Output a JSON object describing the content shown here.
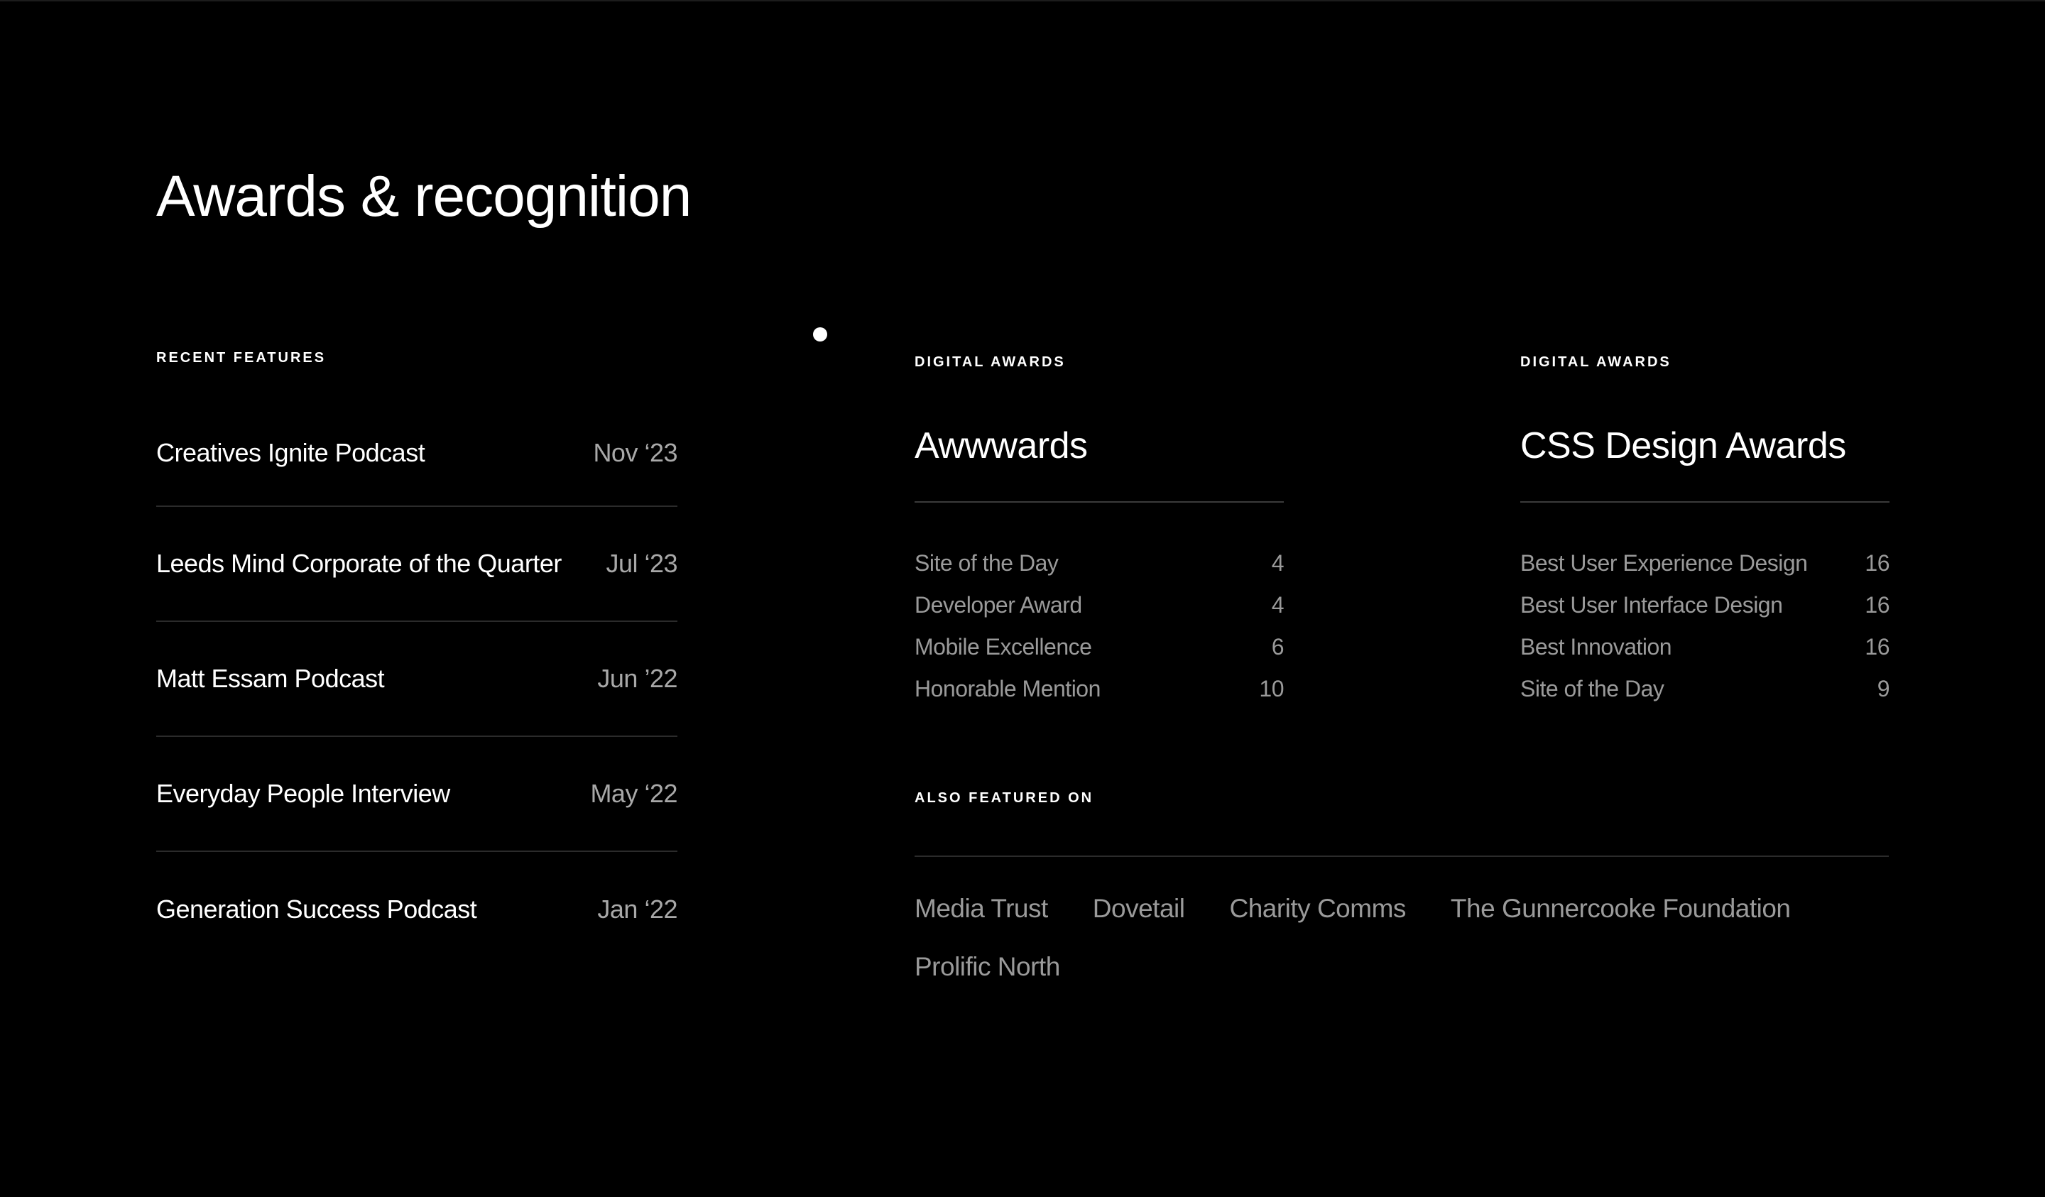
{
  "page": {
    "title": "Awards & recognition"
  },
  "recent_features": {
    "heading": "Recent features",
    "items": [
      {
        "name": "Creatives Ignite Podcast",
        "date": "Nov ‘23"
      },
      {
        "name": "Leeds Mind Corporate of the Quarter",
        "date": "Jul ‘23"
      },
      {
        "name": "Matt Essam Podcast",
        "date": "Jun ’22"
      },
      {
        "name": "Everyday People Interview",
        "date": "May ‘22"
      },
      {
        "name": "Generation Success Podcast",
        "date": "Jan ‘22"
      }
    ]
  },
  "awards": [
    {
      "eyebrow": "Digital awards",
      "title": "Awwwards",
      "items": [
        {
          "label": "Site of the Day",
          "count": "4"
        },
        {
          "label": "Developer Award",
          "count": "4"
        },
        {
          "label": "Mobile Excellence",
          "count": "6"
        },
        {
          "label": "Honorable Mention",
          "count": "10"
        }
      ]
    },
    {
      "eyebrow": "Digital awards",
      "title": "CSS Design Awards",
      "items": [
        {
          "label": "Best User Experience Design",
          "count": "16"
        },
        {
          "label": "Best User Interface Design",
          "count": "16"
        },
        {
          "label": "Best Innovation",
          "count": "16"
        },
        {
          "label": "Site of the Day",
          "count": "9"
        }
      ]
    }
  ],
  "also_featured": {
    "heading": "Also featured on",
    "links": [
      "Media Trust",
      "Dovetail",
      "Charity Comms",
      "The Gunnercooke Foundation",
      "Prolific North"
    ]
  },
  "colors": {
    "background": "#000000",
    "text_primary": "#ffffff",
    "text_muted": "#9a9a9a",
    "divider": "#2b2b2b"
  }
}
